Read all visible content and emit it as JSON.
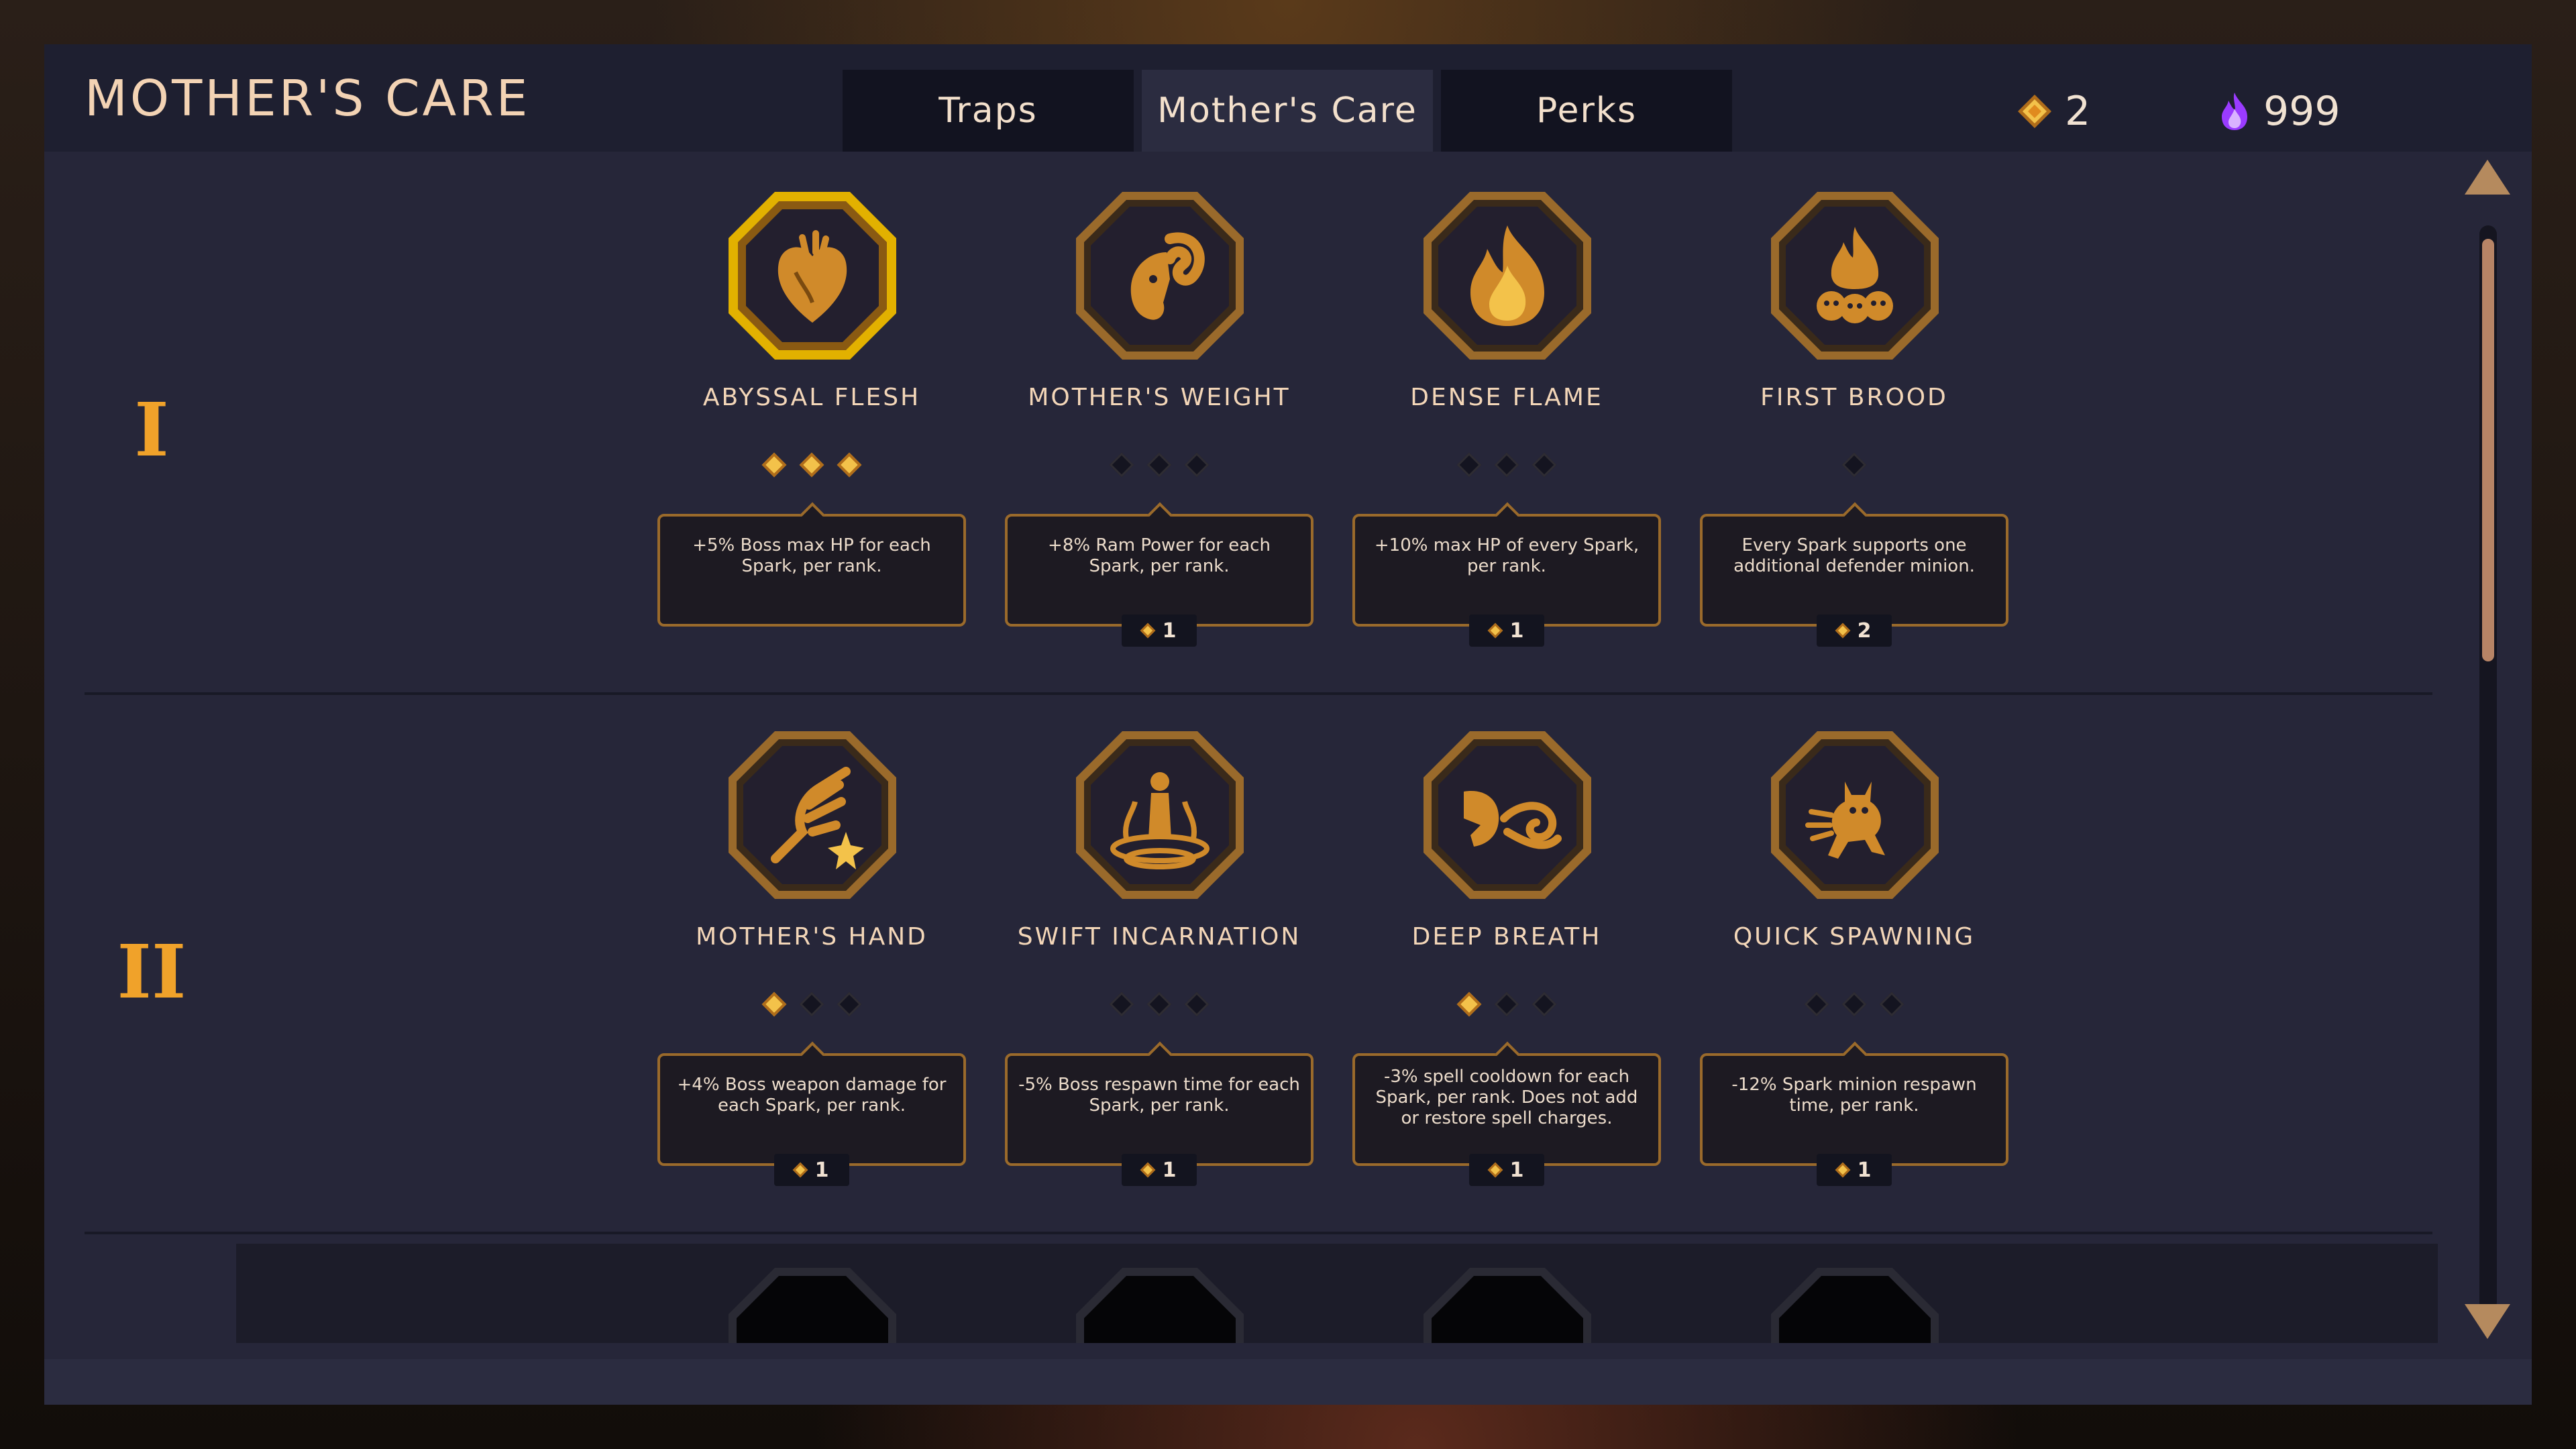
{
  "header": {
    "title": "MOTHER'S CARE",
    "tabs": [
      {
        "label": "Traps",
        "active": false
      },
      {
        "label": "Mother's Care",
        "active": true
      },
      {
        "label": "Perks",
        "active": false
      }
    ],
    "currencies": [
      {
        "icon": "gold-diamond-icon",
        "value": "2"
      },
      {
        "icon": "purple-flame-icon",
        "value": "999"
      }
    ]
  },
  "tiers": [
    {
      "label": "I",
      "perks": [
        {
          "name": "ABYSSAL FLESH",
          "icon": "heart-icon",
          "ranks_filled": 3,
          "ranks_total": 3,
          "description": "+5% Boss max HP for each Spark, per rank.",
          "cost": "",
          "selected": true
        },
        {
          "name": "MOTHER'S WEIGHT",
          "icon": "ram-head-icon",
          "ranks_filled": 0,
          "ranks_total": 3,
          "description": "+8% Ram Power for each Spark, per rank.",
          "cost": "1",
          "selected": false
        },
        {
          "name": "DENSE FLAME",
          "icon": "flame-icon",
          "ranks_filled": 0,
          "ranks_total": 3,
          "description": "+10% max HP of every Spark, per rank.",
          "cost": "1",
          "selected": false
        },
        {
          "name": "FIRST BROOD",
          "icon": "brood-flame-icon",
          "ranks_filled": 0,
          "ranks_total": 1,
          "description": "Every Spark supports one additional defender minion.",
          "cost": "2",
          "selected": false
        }
      ]
    },
    {
      "label": "II",
      "perks": [
        {
          "name": "MOTHER'S HAND",
          "icon": "clawed-hand-icon",
          "ranks_filled": 1,
          "ranks_total": 3,
          "description": "+4% Boss weapon damage for each Spark, per rank.",
          "cost": "1",
          "selected": false
        },
        {
          "name": "SWIFT INCARNATION",
          "icon": "incarnation-icon",
          "ranks_filled": 0,
          "ranks_total": 3,
          "description": "-5% Boss respawn time for each Spark, per rank.",
          "cost": "1",
          "selected": false
        },
        {
          "name": "DEEP BREATH",
          "icon": "breath-icon",
          "ranks_filled": 1,
          "ranks_total": 3,
          "description": "-3% spell cooldown for each Spark, per rank. Does not add or restore spell charges.",
          "cost": "1",
          "selected": false
        },
        {
          "name": "QUICK SPAWNING",
          "icon": "imp-icon",
          "ranks_filled": 0,
          "ranks_total": 3,
          "description": "-12% Spark minion respawn time, per rank.",
          "cost": "1",
          "selected": false
        }
      ]
    }
  ],
  "colors": {
    "accent_gold": "#f0a22a",
    "panel_bg": "#262639",
    "frame_bronze": "#9a6a2b",
    "currency_purple": "#a64dff"
  }
}
